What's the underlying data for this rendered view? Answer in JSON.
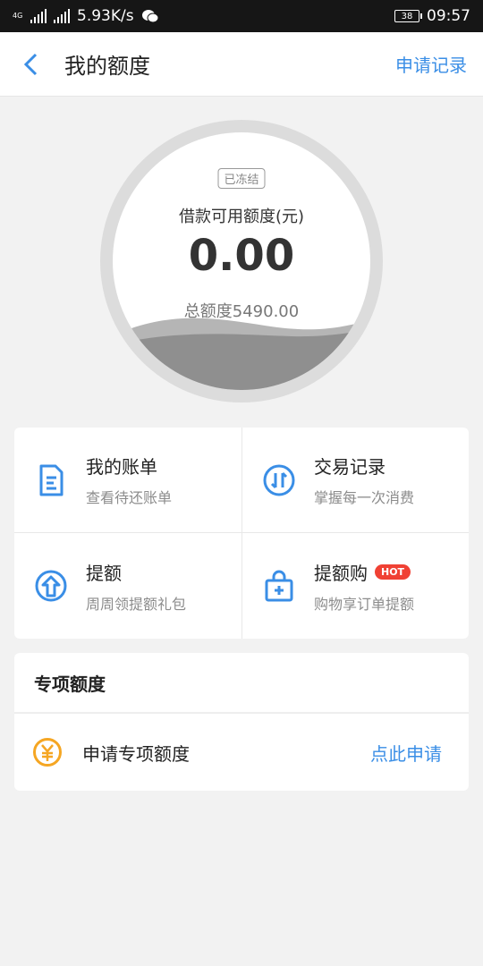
{
  "status_bar": {
    "net_type": "4G",
    "speed": "5.93K/s",
    "battery": "38",
    "time": "09:57"
  },
  "header": {
    "title": "我的额度",
    "record_link": "申请记录"
  },
  "credit": {
    "status_badge": "已冻结",
    "available_label": "借款可用额度(元)",
    "available_amount": "0.00",
    "total_label": "总额度5490.00"
  },
  "grid": [
    {
      "title": "我的账单",
      "subtitle": "查看待还账单",
      "icon": "bill-icon"
    },
    {
      "title": "交易记录",
      "subtitle": "掌握每一次消费",
      "icon": "exchange-icon"
    },
    {
      "title": "提额",
      "subtitle": "周周领提额礼包",
      "icon": "raise-limit-icon"
    },
    {
      "title": "提额购",
      "subtitle": "购物享订单提额",
      "icon": "shopping-bag-icon",
      "badge": "HOT"
    }
  ],
  "special": {
    "title": "专项额度",
    "row_label": "申请专项额度",
    "row_action": "点此申请"
  },
  "colors": {
    "accent": "#3a8ee6",
    "hot": "#f04134",
    "coin": "#f5a623"
  }
}
